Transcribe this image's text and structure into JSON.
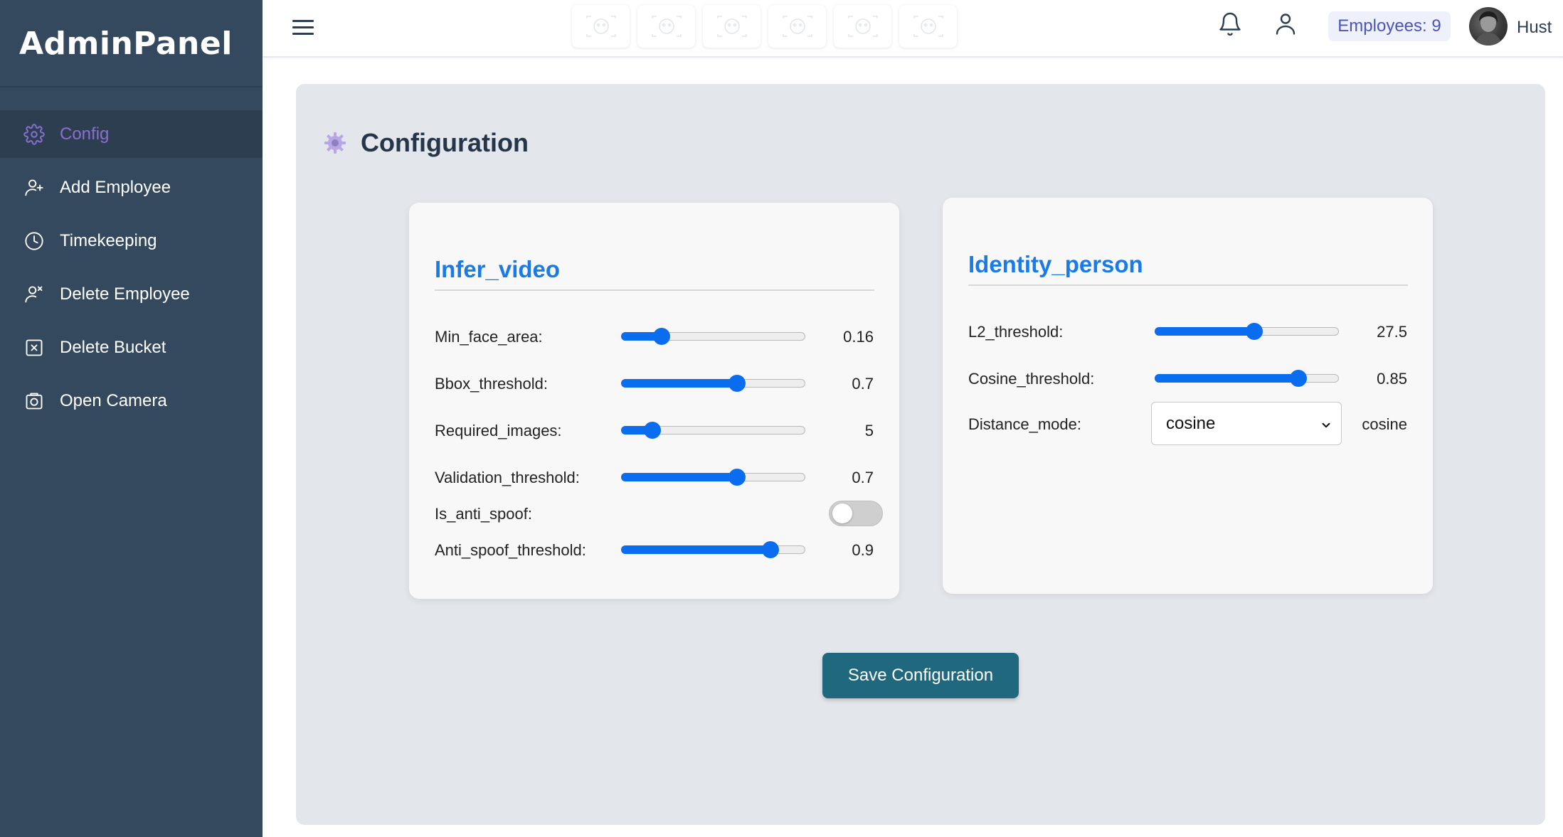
{
  "brand": "AdminPanel",
  "sidebar": {
    "items": [
      {
        "label": "Config",
        "icon": "gear-icon",
        "active": true
      },
      {
        "label": "Add Employee",
        "icon": "user-plus-icon"
      },
      {
        "label": "Timekeeping",
        "icon": "clock-icon"
      },
      {
        "label": "Delete Employee",
        "icon": "user-x-icon"
      },
      {
        "label": "Delete Bucket",
        "icon": "x-square-icon"
      },
      {
        "label": "Open Camera",
        "icon": "camera-icon"
      }
    ]
  },
  "topbar": {
    "employee_count": "Employees: 9",
    "username": "Hust",
    "thumbnail_count": 6
  },
  "page": {
    "title": "Configuration"
  },
  "infer_video": {
    "title": "Infer_video",
    "min_face_area": {
      "label": "Min_face_area:",
      "value": "0.16",
      "fraction": 0.22
    },
    "bbox_threshold": {
      "label": "Bbox_threshold:",
      "value": "0.7",
      "fraction": 0.63
    },
    "required_images": {
      "label": "Required_images:",
      "value": "5",
      "fraction": 0.17
    },
    "validation_threshold": {
      "label": "Validation_threshold:",
      "value": "0.7",
      "fraction": 0.63
    },
    "is_anti_spoof": {
      "label": "Is_anti_spoof:",
      "checked": false
    },
    "anti_spoof_threshold": {
      "label": "Anti_spoof_threshold:",
      "value": "0.9",
      "fraction": 0.81
    }
  },
  "identity_person": {
    "title": "Identity_person",
    "l2_threshold": {
      "label": "L2_threshold:",
      "value": "27.5",
      "fraction": 0.54
    },
    "cosine_threshold": {
      "label": "Cosine_threshold:",
      "value": "0.85",
      "fraction": 0.78
    },
    "distance_mode": {
      "label": "Distance_mode:",
      "selected": "cosine",
      "value": "cosine"
    }
  },
  "save_label": "Save Configuration",
  "colors": {
    "sidebar": "#34495e",
    "accent": "#0a6df0",
    "active_nav": "#8a6fd1",
    "save_button": "#20687e",
    "card_title": "#1a7be6"
  }
}
